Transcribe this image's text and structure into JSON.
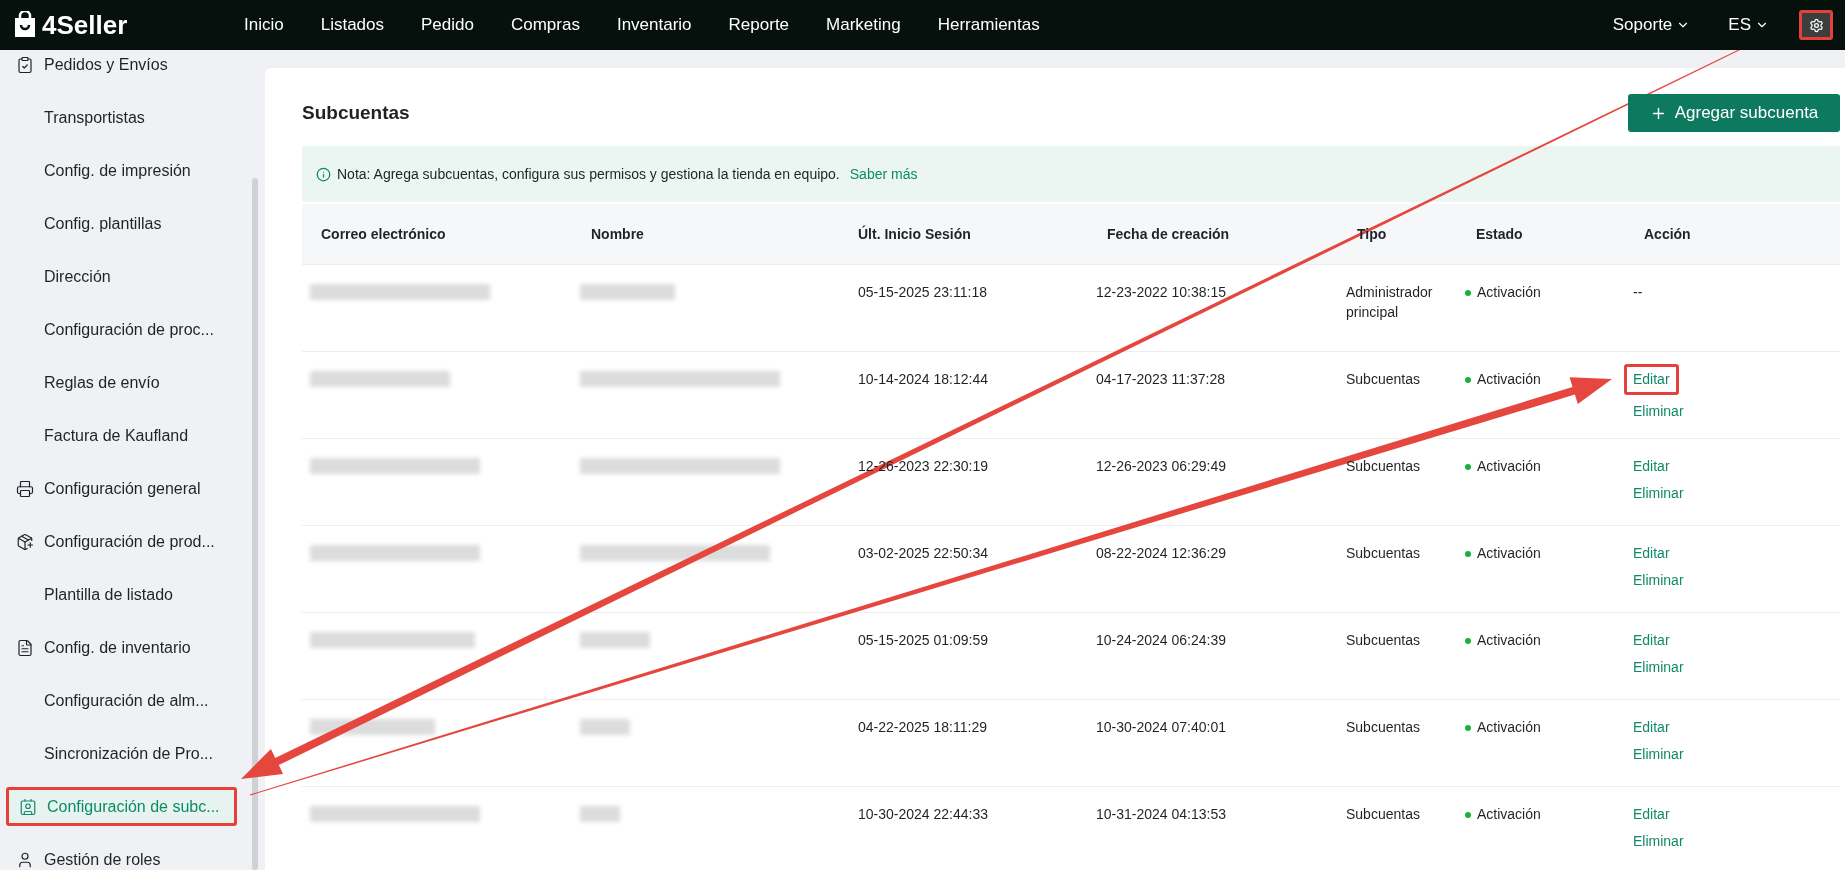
{
  "topbar": {
    "logo": "4Seller",
    "nav": [
      "Inicio",
      "Listados",
      "Pedido",
      "Compras",
      "Inventario",
      "Reporte",
      "Marketing",
      "Herramientas"
    ],
    "support": "Soporte",
    "language": "ES",
    "settings_highlighted": true
  },
  "sidebar": {
    "items": [
      {
        "kind": "group",
        "label": "Pedidos y Envíos",
        "selected": false,
        "highlighted": false
      },
      {
        "kind": "item",
        "label": "Transportistas",
        "selected": false,
        "highlighted": false
      },
      {
        "kind": "item",
        "label": "Config. de impresión",
        "selected": false,
        "highlighted": false
      },
      {
        "kind": "item",
        "label": "Config. plantillas",
        "selected": false,
        "highlighted": false
      },
      {
        "kind": "item",
        "label": "Dirección",
        "selected": false,
        "highlighted": false
      },
      {
        "kind": "item",
        "label": "Configuración de proc...",
        "selected": false,
        "highlighted": false
      },
      {
        "kind": "item",
        "label": "Reglas de envío",
        "selected": false,
        "highlighted": false
      },
      {
        "kind": "item",
        "label": "Factura de Kaufland",
        "selected": false,
        "highlighted": false
      },
      {
        "kind": "group",
        "label": "Configuración general",
        "selected": false,
        "highlighted": false
      },
      {
        "kind": "group",
        "label": "Configuración de prod...",
        "selected": false,
        "highlighted": false
      },
      {
        "kind": "item",
        "label": "Plantilla de listado",
        "selected": false,
        "highlighted": false
      },
      {
        "kind": "group",
        "label": "Config. de inventario",
        "selected": false,
        "highlighted": false
      },
      {
        "kind": "item",
        "label": "Configuración de alm...",
        "selected": false,
        "highlighted": false
      },
      {
        "kind": "item",
        "label": "Sincronización de Pro...",
        "selected": false,
        "highlighted": false
      },
      {
        "kind": "group",
        "label": "Configuración de subc...",
        "selected": true,
        "highlighted": true
      },
      {
        "kind": "group",
        "label": "Gestión de roles",
        "selected": false,
        "highlighted": false
      }
    ]
  },
  "page": {
    "title": "Subcuentas",
    "add_button": "Agregar subcuenta",
    "note": "Nota: Agrega subcuentas, configura sus permisos y gestiona la tienda en equipo.",
    "note_link": "Saber más"
  },
  "table": {
    "columns": [
      "Correo electrónico",
      "Nombre",
      "Últ. Inicio Sesión",
      "Fecha de creación",
      "Tipo",
      "Estado",
      "Acción"
    ],
    "rows": [
      {
        "last_login": "05-15-2025 23:11:18",
        "created": "12-23-2022 10:38:15",
        "type": "Administrador principal",
        "status": {
          "label": "Activación",
          "color": "#16b33a"
        },
        "action": {
          "kind": "text",
          "text": "--"
        }
      },
      {
        "last_login": "10-14-2024 18:12:44",
        "created": "04-17-2023 11:37:28",
        "type": "Subcuentas",
        "status": {
          "label": "Activación",
          "color": "#16b33a"
        },
        "action": {
          "kind": "links",
          "links": [
            {
              "label": "Editar",
              "highlighted": true
            },
            {
              "label": "Eliminar",
              "highlighted": false
            }
          ]
        }
      },
      {
        "last_login": "12-26-2023 22:30:19",
        "created": "12-26-2023 06:29:49",
        "type": "Subcuentas",
        "status": {
          "label": "Activación",
          "color": "#16b33a"
        },
        "action": {
          "kind": "links",
          "links": [
            {
              "label": "Editar",
              "highlighted": false
            },
            {
              "label": "Eliminar",
              "highlighted": false
            }
          ]
        }
      },
      {
        "last_login": "03-02-2025 22:50:34",
        "created": "08-22-2024 12:36:29",
        "type": "Subcuentas",
        "status": {
          "label": "Activación",
          "color": "#16b33a"
        },
        "action": {
          "kind": "links",
          "links": [
            {
              "label": "Editar",
              "highlighted": false
            },
            {
              "label": "Eliminar",
              "highlighted": false
            }
          ]
        }
      },
      {
        "last_login": "05-15-2025 01:09:59",
        "created": "10-24-2024 06:24:39",
        "type": "Subcuentas",
        "status": {
          "label": "Activación",
          "color": "#16b33a"
        },
        "action": {
          "kind": "links",
          "links": [
            {
              "label": "Editar",
              "highlighted": false
            },
            {
              "label": "Eliminar",
              "highlighted": false
            }
          ]
        }
      },
      {
        "last_login": "04-22-2025 18:11:29",
        "created": "10-30-2024 07:40:01",
        "type": "Subcuentas",
        "status": {
          "label": "Activación",
          "color": "#16b33a"
        },
        "action": {
          "kind": "links",
          "links": [
            {
              "label": "Editar",
              "highlighted": false
            },
            {
              "label": "Eliminar",
              "highlighted": false
            }
          ]
        }
      },
      {
        "last_login": "10-30-2024 22:44:33",
        "created": "10-31-2024 04:13:53",
        "type": "Subcuentas",
        "status": {
          "label": "Activación",
          "color": "#16b33a"
        },
        "action": {
          "kind": "links",
          "links": [
            {
              "label": "Editar",
              "highlighted": false
            },
            {
              "label": "Eliminar",
              "highlighted": false
            }
          ]
        }
      }
    ]
  }
}
